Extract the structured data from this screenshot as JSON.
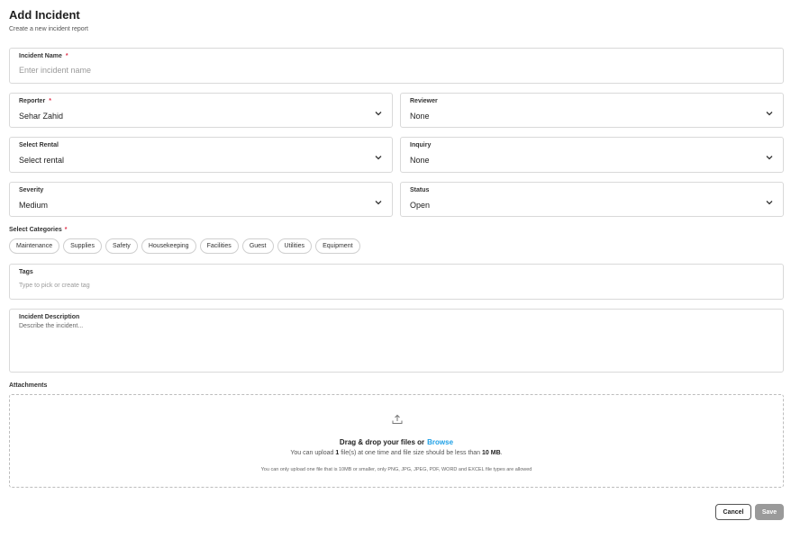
{
  "header": {
    "title": "Add Incident",
    "subtitle": "Create a new incident report"
  },
  "form": {
    "incident_name": {
      "label": "Incident Name",
      "required_mark": "*",
      "placeholder": "Enter incident name"
    },
    "reporter": {
      "label": "Reporter",
      "required_mark": "*",
      "value": "Sehar Zahid"
    },
    "reviewer": {
      "label": "Reviewer",
      "value": "None"
    },
    "rental": {
      "label": "Select Rental",
      "value": "Select rental"
    },
    "inquiry": {
      "label": "Inquiry",
      "value": "None"
    },
    "severity": {
      "label": "Severity",
      "value": "Medium"
    },
    "status": {
      "label": "Status",
      "value": "Open"
    },
    "categories": {
      "label": "Select Categories",
      "required_mark": "*",
      "items": [
        "Maintenance",
        "Supplies",
        "Safety",
        "Housekeeping",
        "Facilities",
        "Guest",
        "Utilities",
        "Equipment"
      ]
    },
    "tags": {
      "label": "Tags",
      "placeholder": "Type to pick or create tag"
    },
    "description": {
      "label": "Incident Description",
      "placeholder": "Describe the incident..."
    }
  },
  "attachments": {
    "label": "Attachments",
    "drag_text": "Drag & drop your files or",
    "browse_text": "Browse",
    "limit_pre": "You can upload",
    "limit_count": "1",
    "limit_mid": "file(s) at one time and file size should be less than",
    "limit_size": "10 MB",
    "limit_end": ".",
    "note": "You can only upload one file that is 10MB or smaller, only PNG, JPG, JPEG, PDF, WORD and EXCEL file types are allowed"
  },
  "actions": {
    "cancel_label": "Cancel",
    "save_label": "Save"
  },
  "icons": {
    "dropdown": "chevron-down-icon",
    "upload": "upload-icon"
  },
  "colors": {
    "required": "#e0314b",
    "link": "#1ea0e6",
    "save_disabled": "#9a9a9a"
  }
}
